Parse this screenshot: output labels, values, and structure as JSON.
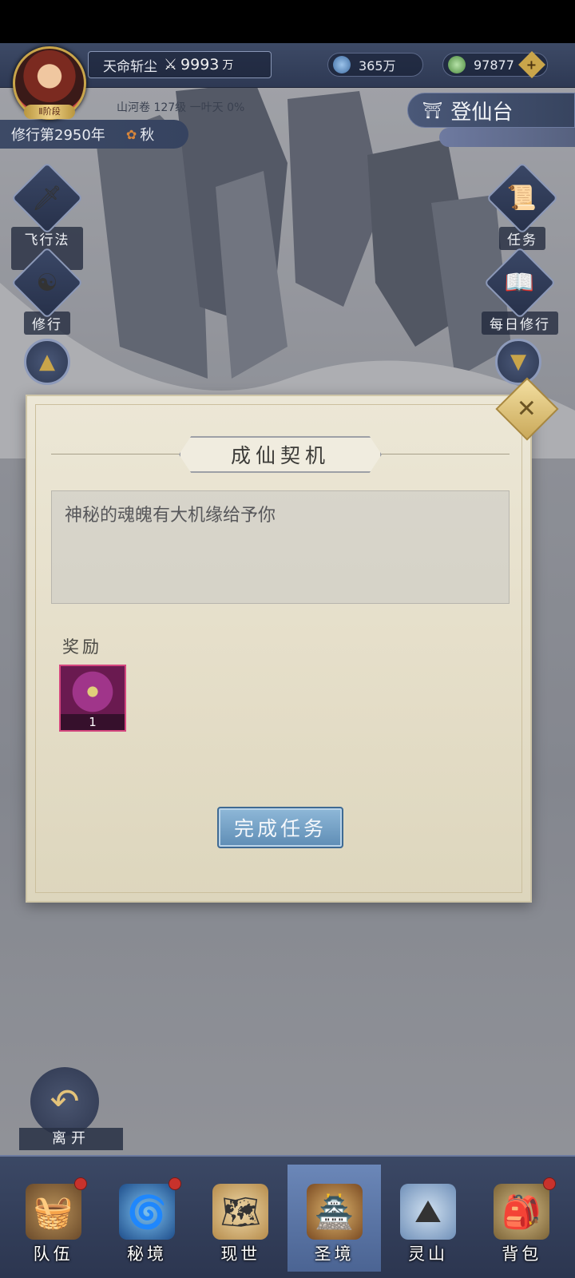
{
  "player": {
    "avatar_badge": "Ⅱ阶段",
    "title": "天命斩尘",
    "power": "9993",
    "power_unit": "万",
    "realm_info": "山河卷 127级  一叶天 0%"
  },
  "resources": {
    "spirit_stones": "365万",
    "jade": "97877",
    "plus_label": "+"
  },
  "status": {
    "year": "修行第2950年",
    "season": "秋"
  },
  "stage_button": {
    "label": "登仙台"
  },
  "left_icons": [
    {
      "label": "飞行法器",
      "icon": "flying-artifact-icon"
    },
    {
      "label": "修行",
      "icon": "cultivator-icon"
    }
  ],
  "right_icons": [
    {
      "label": "任务",
      "icon": "task-scroll-icon"
    },
    {
      "label": "每日修行",
      "icon": "daily-book-icon"
    }
  ],
  "dialog": {
    "title": "成仙契机",
    "description": "神秘的魂魄有大机缘给予你",
    "reward_label": "奖励",
    "rewards": [
      {
        "qty": "1",
        "icon": "mystic-orb-icon"
      }
    ],
    "complete_label": "完成任务",
    "close_icon": "close-icon"
  },
  "leave": {
    "label": "离开",
    "icon": "back-arrow-icon"
  },
  "bottom_nav": [
    {
      "label": "队伍",
      "icon": "team-icon",
      "badge": true,
      "active": false
    },
    {
      "label": "秘境",
      "icon": "secret-realm-icon",
      "badge": true,
      "active": false
    },
    {
      "label": "现世",
      "icon": "world-icon",
      "badge": false,
      "active": false
    },
    {
      "label": "圣境",
      "icon": "holy-realm-icon",
      "badge": false,
      "active": true
    },
    {
      "label": "灵山",
      "icon": "spirit-mountain-icon",
      "badge": false,
      "active": false
    },
    {
      "label": "背包",
      "icon": "bag-icon",
      "badge": true,
      "active": false
    }
  ],
  "colors": {
    "panel_bg": "#e9e3d1",
    "primary_button": "#6f9bc3",
    "accent_gold": "#c9a54a",
    "nav_bg": "#34405c",
    "nav_active": "#5a76a8",
    "badge_red": "#c8322c"
  }
}
